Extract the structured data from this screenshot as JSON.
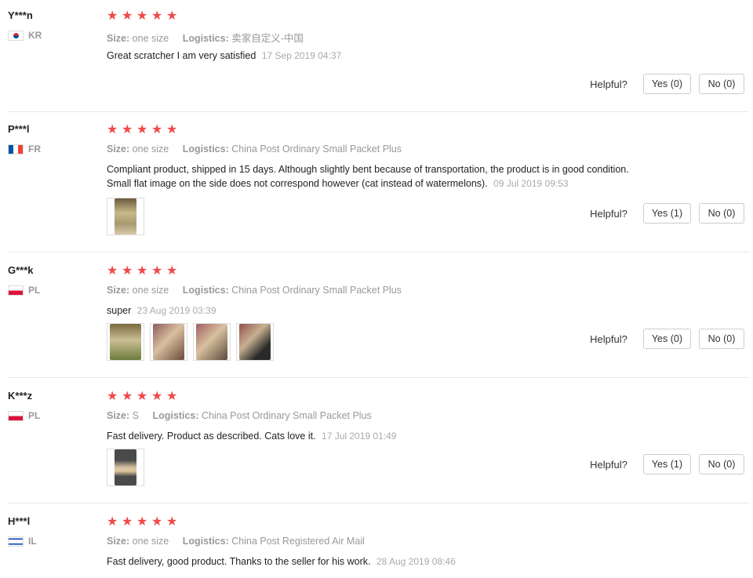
{
  "labels": {
    "size": "Size:",
    "logistics": "Logistics:",
    "helpful": "Helpful?"
  },
  "star_count": 5,
  "reviews": [
    {
      "user": "Y***n",
      "country": "KR",
      "flag": "kr",
      "size": "one size",
      "logistics": "卖家自定义-中国",
      "text": "Great scratcher I am very satisfied",
      "date": "17 Sep 2019 04:37",
      "photos": [],
      "yes": "Yes (0)",
      "no": "No (0)"
    },
    {
      "user": "P***l",
      "country": "FR",
      "flag": "fr",
      "size": "one size",
      "logistics": "China Post Ordinary Small Packet Plus",
      "text": "Compliant product, shipped in 15 days. Although slightly bent because of transportation, the product is in good condition. Small flat image on the side does not correspond however (cat instead of watermelons).",
      "date": "09 Jul 2019 09:53",
      "photos": [
        "photo-1"
      ],
      "yes": "Yes (1)",
      "no": "No (0)"
    },
    {
      "user": "G***k",
      "country": "PL",
      "flag": "pl",
      "size": "one size",
      "logistics": "China Post Ordinary Small Packet Plus",
      "text": "super",
      "date": "23 Aug 2019 03:39",
      "photos": [
        "photo-1",
        "photo-2",
        "photo-3",
        "photo-4"
      ],
      "yes": "Yes (0)",
      "no": "No (0)"
    },
    {
      "user": "K***z",
      "country": "PL",
      "flag": "pl",
      "size": "S",
      "logistics": "China Post Ordinary Small Packet Plus",
      "text": "Fast delivery. Product as described. Cats love it.",
      "date": "17 Jul 2019 01:49",
      "photos": [
        "photo-1"
      ],
      "yes": "Yes (1)",
      "no": "No (0)"
    },
    {
      "user": "H***l",
      "country": "IL",
      "flag": "il",
      "size": "one size",
      "logistics": "China Post Registered Air Mail",
      "text": "Fast delivery, good product. Thanks to the seller for his work.",
      "date": "28 Aug 2019 08:46",
      "photos": [],
      "yes": "",
      "no": ""
    }
  ],
  "colors": {
    "star": "#ef4a4a",
    "meta": "#999999",
    "divider": "#e8e8e8"
  }
}
